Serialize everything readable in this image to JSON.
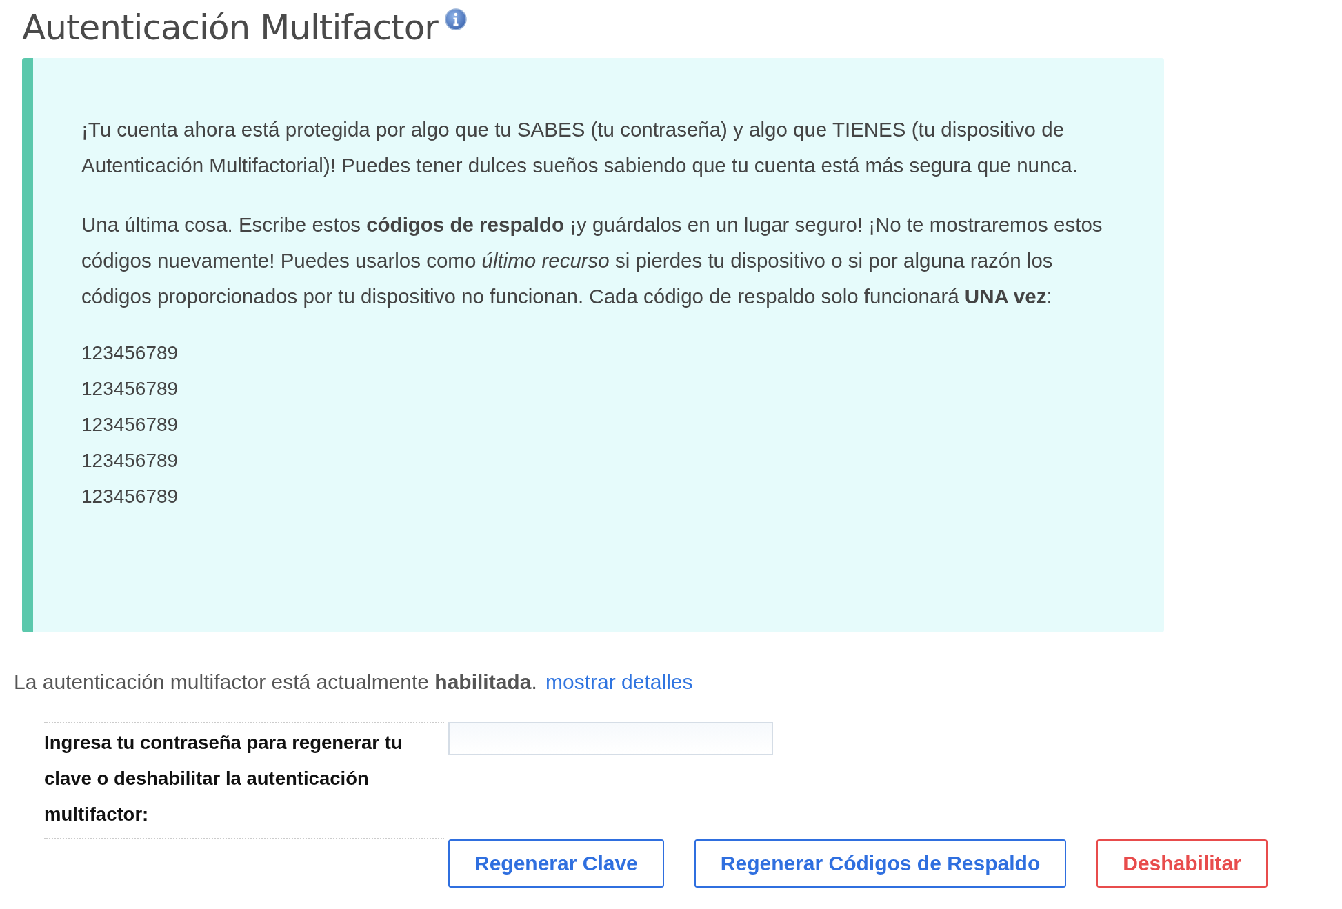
{
  "title": "Autenticación Multifactor",
  "panel": {
    "paragraphs": [
      "¡Tu cuenta ahora está protegida por algo que tu SABES (tu contraseña) y algo que TIENES (tu dispositivo de Autenticación Multifactorial)! Puedes tener dulces sueños sabiendo que tu cuenta está más segura que nunca.",
      "Una última cosa. Escribe estos **códigos de respaldo** ¡y guárdalos en un lugar seguro! ¡No te mostraremos estos códigos nuevamente! Puedes usarlos como *último recurso* si pierdes tu dispositivo o si por alguna razón los códigos proporcionados por tu dispositivo no funcionan. Cada código de respaldo solo funcionará **UNA vez**:"
    ],
    "codes": [
      "123456789",
      "123456789",
      "123456789",
      "123456789",
      "123456789"
    ]
  },
  "status": {
    "text": "La autenticación multifactor está actualmente **habilitada**.",
    "link": "mostrar detalles"
  },
  "form": {
    "label": "Ingresa tu contraseña para regenerar tu clave o deshabilitar la autenticación multifactor:"
  },
  "buttons": [
    {
      "label": "Regenerar Clave",
      "kind": "primary"
    },
    {
      "label": "Regenerar Códigos de Respaldo",
      "kind": "primary"
    },
    {
      "label": "Deshabilitar",
      "kind": "danger"
    }
  ]
}
